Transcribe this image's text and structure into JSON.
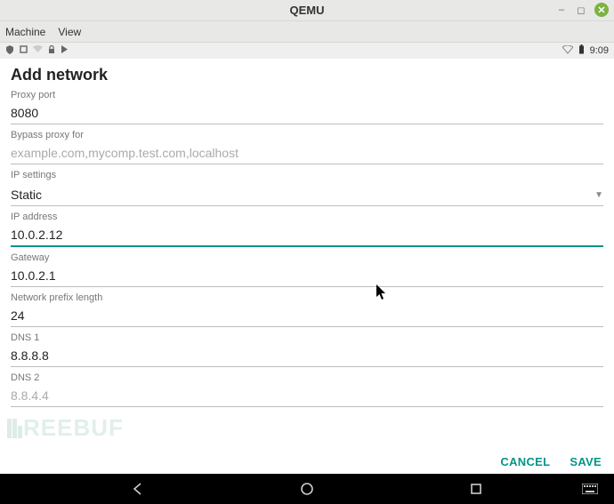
{
  "window": {
    "title": "QEMU"
  },
  "menubar": {
    "machine": "Machine",
    "view": "View"
  },
  "statusbar": {
    "time": "9:09",
    "left_icons": [
      "shield-icon",
      "box-icon",
      "wifi-dim-icon",
      "lock-icon",
      "play-icon"
    ],
    "right_icons": [
      "wifi-icon",
      "battery-icon"
    ]
  },
  "form": {
    "heading": "Add network",
    "proxy_port": {
      "label": "Proxy port",
      "value": "8080"
    },
    "bypass": {
      "label": "Bypass proxy for",
      "placeholder": "example.com,mycomp.test.com,localhost",
      "value": ""
    },
    "ip_settings": {
      "label": "IP settings",
      "value": "Static"
    },
    "ip_address": {
      "label": "IP address",
      "value": "10.0.2.12"
    },
    "gateway": {
      "label": "Gateway",
      "value": "10.0.2.1"
    },
    "prefix": {
      "label": "Network prefix length",
      "value": "24"
    },
    "dns1": {
      "label": "DNS 1",
      "value": "8.8.8.8"
    },
    "dns2": {
      "label": "DNS 2",
      "placeholder": "8.8.4.4",
      "value": ""
    }
  },
  "actions": {
    "cancel": "CANCEL",
    "save": "SAVE"
  },
  "colors": {
    "accent": "#009688",
    "text": "#222",
    "muted": "#777"
  }
}
